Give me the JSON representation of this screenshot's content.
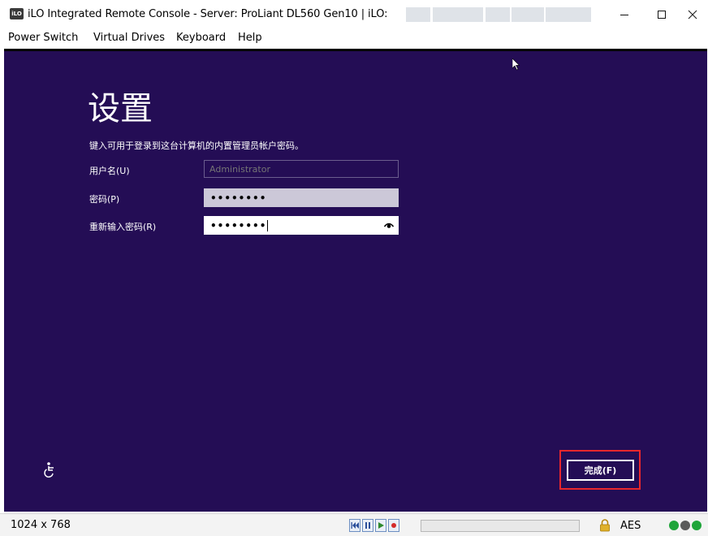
{
  "window": {
    "app_icon_text": "iLO",
    "title": "iLO Integrated Remote Console - Server: ProLiant DL560 Gen10 | iLO:"
  },
  "menu": {
    "items": [
      "Power Switch",
      "Virtual Drives",
      "Keyboard",
      "Help"
    ]
  },
  "setup": {
    "title": "设置",
    "instruction": "键入可用于登录到这台计算机的内置管理员帐户密码。",
    "username_label": "用户名(U)",
    "username_placeholder": "Administrator",
    "password_label": "密码(P)",
    "password_mask": "••••••••",
    "reenter_label": "重新输入密码(R)",
    "reenter_mask": "••••••••",
    "finish_button": "完成(F)"
  },
  "statusbar": {
    "resolution": "1024 x 768",
    "encryption": "AES"
  },
  "colors": {
    "screen_bg": "#240d55",
    "highlight": "#e8272c"
  }
}
